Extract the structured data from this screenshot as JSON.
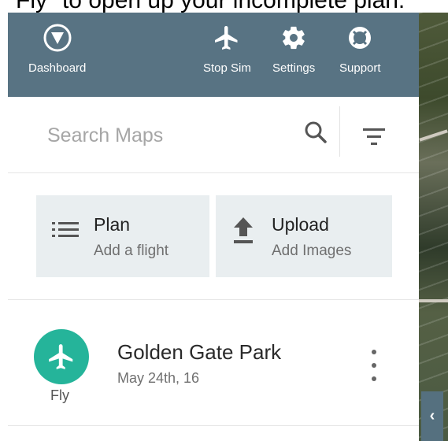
{
  "caption": {
    "text": "Fly\" to open up your incomplete plan."
  },
  "header": {
    "dashboard_label": "Dashboard",
    "stop_sim_label": "Stop Sim",
    "settings_label": "Settings",
    "support_label": "Support"
  },
  "search": {
    "placeholder": "Search Maps"
  },
  "actions": {
    "plan": {
      "title": "Plan",
      "subtitle": "Add a flight"
    },
    "upload": {
      "title": "Upload",
      "subtitle": "Add Images"
    }
  },
  "maps": [
    {
      "name": "Golden Gate Park",
      "date": "May 24th, 16",
      "action_label": "Fly"
    }
  ],
  "colors": {
    "header": "#587383",
    "fly_accent": "#25b49a",
    "card_bg": "#e9eef0"
  },
  "icons": {
    "dashboard": "compass-icon",
    "stop_sim": "airplane-icon",
    "settings": "gear-icon",
    "support": "lifebuoy-icon",
    "search": "search-icon",
    "filter": "filter-icon",
    "plan": "list-icon",
    "upload": "upload-icon",
    "fly": "airplane-icon",
    "more": "kebab-icon",
    "collapse": "chevron-left-icon"
  }
}
